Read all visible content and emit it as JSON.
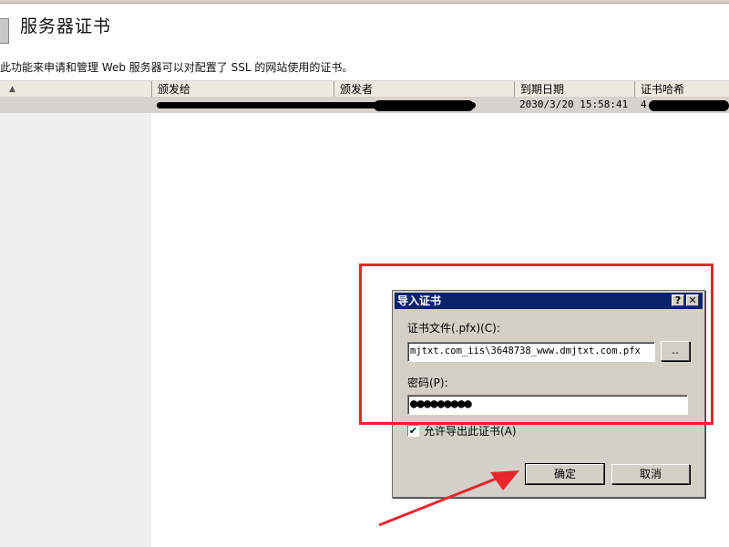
{
  "page": {
    "title": "服务器证书",
    "description": "此功能来申请和管理 Web 服务器可以对配置了 SSL 的网站使用的证书。"
  },
  "list": {
    "columns": [
      "颁发给",
      "颁发者",
      "到期日期",
      "证书哈希"
    ],
    "rows": [
      {
        "expiry": "2030/3/20 15:58:41",
        "hash_prefix": "4"
      }
    ]
  },
  "dialog": {
    "title": "导入证书",
    "help_label": "?",
    "close_label": "✕",
    "file_label": "证书文件(.pfx)(C):",
    "file_value": "mjtxt.com_iis\\3648738_www.dmjtxt.com.pfx",
    "browse_label": "..",
    "password_label": "密码(P):",
    "password_value": "●●●●●●●●●",
    "allow_export_label": "允许导出此证书(A)",
    "allow_export_checked": "✔",
    "ok_label": "确定",
    "cancel_label": "取消"
  },
  "colors": {
    "titlebar": "#0a246a",
    "highlight": "#e8262b",
    "dialog_bg": "#d4d0c8"
  },
  "icons": {
    "page_icon": "certificate-icon",
    "sort": "sort-ascending-icon",
    "annotation": "red-arrow-icon"
  }
}
